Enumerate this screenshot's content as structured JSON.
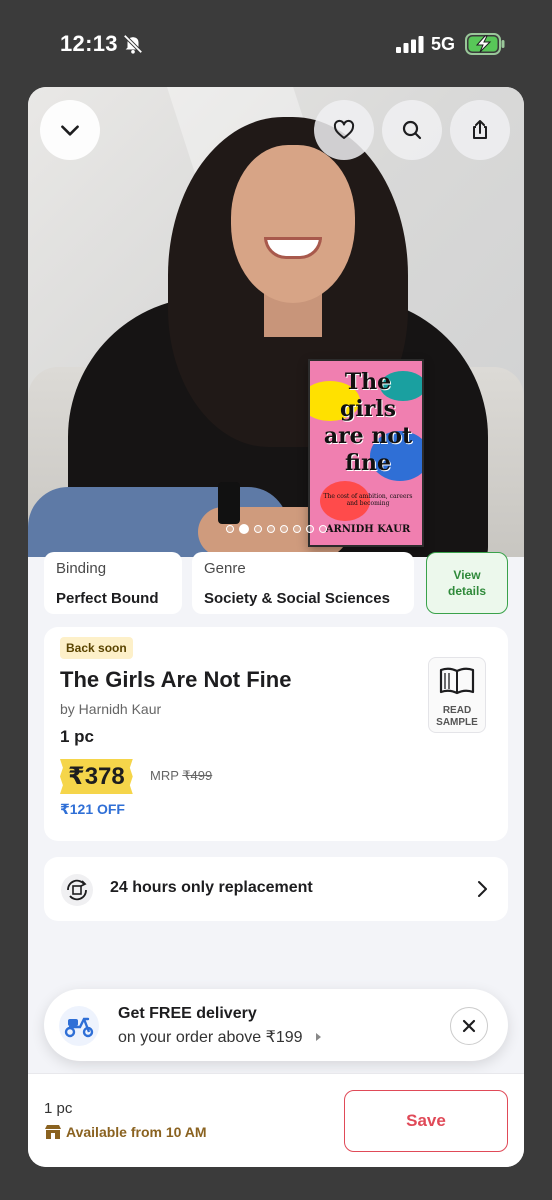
{
  "status_bar": {
    "time": "12:13",
    "network": "5G"
  },
  "hero": {
    "image_count": 8,
    "active_index": 1,
    "book_cover": {
      "title_lines": [
        "The",
        "girls",
        "are not",
        "fine"
      ],
      "tagline": "The cost of ambition, careers and becoming",
      "author": "ARNIDH KAUR"
    }
  },
  "attributes": [
    {
      "label": "Binding",
      "value": "Perfect Bound"
    },
    {
      "label": "Genre",
      "value": "Society & Social Sciences"
    }
  ],
  "view_details": {
    "line1": "View",
    "line2": "details"
  },
  "product": {
    "badge": "Back soon",
    "title": "The Girls Are Not Fine",
    "author": "by Harnidh Kaur",
    "quantity": "1 pc",
    "price": "₹378",
    "mrp_label": "MRP",
    "mrp_value": "₹499",
    "discount": "₹121 OFF",
    "read_sample": {
      "line1": "READ",
      "line2": "SAMPLE"
    }
  },
  "replacement": {
    "label": "24 hours only replacement"
  },
  "delivery_toast": {
    "title": "Get FREE delivery",
    "subtitle": "on your order above ₹199"
  },
  "bottom_bar": {
    "quantity": "1 pc",
    "availability": "Available from 10 AM",
    "save_label": "Save"
  },
  "colors": {
    "accent_red": "#e04a58",
    "price_yellow": "#f5d54a",
    "discount_blue": "#2f6fd6",
    "details_green": "#3aa24b"
  }
}
